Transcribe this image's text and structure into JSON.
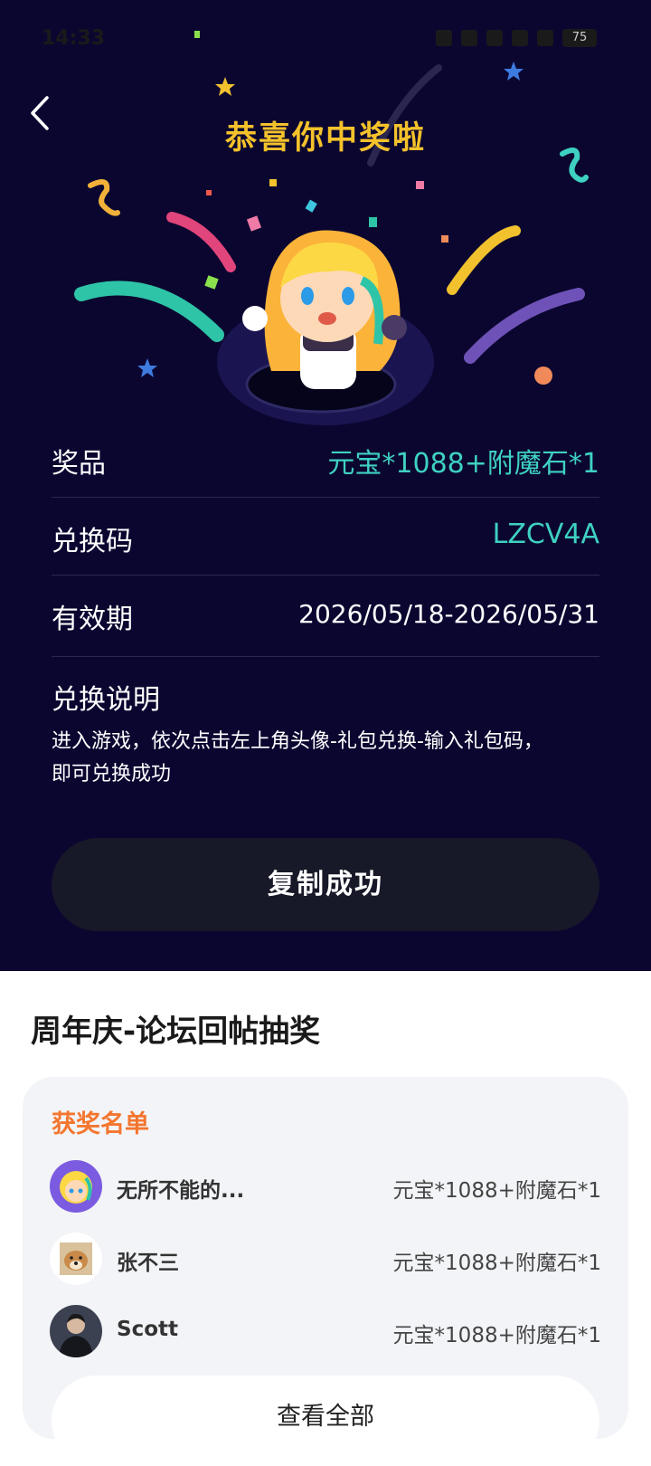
{
  "status_bar": {
    "time": "14:33",
    "battery": "75"
  },
  "header": {
    "title": "恭喜你中奖啦"
  },
  "prize_info": {
    "prize_label": "奖品",
    "prize_value": "元宝*1088+附魔石*1",
    "code_label": "兑换码",
    "code_value": "LZCV4A",
    "validity_label": "有效期",
    "validity_value": "2026/05/18-2026/05/31"
  },
  "instructions": {
    "title": "兑换说明",
    "text_line1": "进入游戏，依次点击左上角头像-礼包兑换-输入礼包码，",
    "text_line2": "即可兑换成功"
  },
  "copy_button": {
    "label": "复制成功"
  },
  "activity": {
    "title": "周年庆-论坛回帖抽奖"
  },
  "winners": {
    "title": "获奖名单",
    "list": [
      {
        "name": "无所不能的...",
        "prize": "元宝*1088+附魔石*1"
      },
      {
        "name": "张不三",
        "prize": "元宝*1088+附魔石*1"
      },
      {
        "name": "Scott",
        "prize": "元宝*1088+附魔石*1"
      }
    ],
    "view_all_label": "查看全部"
  },
  "colors": {
    "background": "#0b0630",
    "accent_gold": "#f4c22b",
    "accent_teal": "#3ed1c1",
    "winners_orange": "#f4762f"
  }
}
